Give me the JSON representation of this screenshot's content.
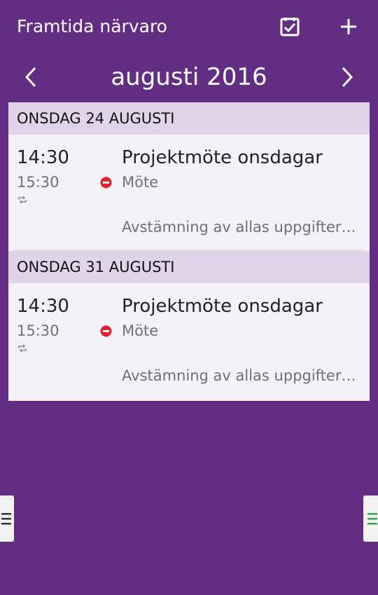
{
  "header": {
    "title": "Framtida närvaro",
    "icons": {
      "check": "checkbox-icon",
      "add": "plus-icon"
    }
  },
  "month_nav": {
    "title": "augusti 2016",
    "prev_icon": "chevron-left-icon",
    "next_icon": "chevron-right-icon"
  },
  "days": [
    {
      "header": "ONSDAG 24 AUGUSTI",
      "events": [
        {
          "start": "14:30",
          "end": "15:30",
          "title": "Projektmöte onsdagar",
          "category": "Möte",
          "description": "Avstämning av allas uppgifter -..."
        }
      ]
    },
    {
      "header": "ONSDAG 31 AUGUSTI",
      "events": [
        {
          "start": "14:30",
          "end": "15:30",
          "title": "Projektmöte onsdagar",
          "category": "Möte",
          "description": "Avstämning av allas uppgifter -..."
        }
      ]
    }
  ],
  "drawers": {
    "left_icon": "menu-icon",
    "right_icon": "menu-icon"
  },
  "colors": {
    "background": "#622D82",
    "day_header": "#E0D5E8",
    "card": "#F5F1F8",
    "status_busy": "#E0202E",
    "right_drawer_accent": "#2FA84F"
  }
}
